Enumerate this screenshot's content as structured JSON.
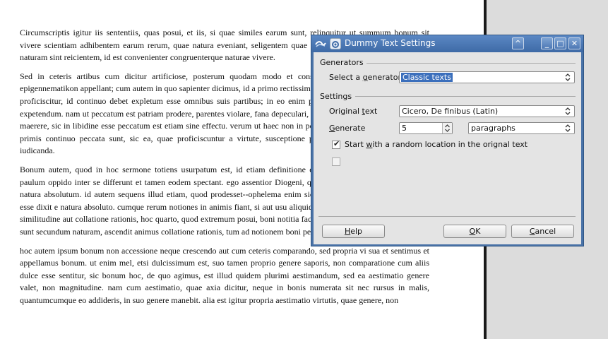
{
  "document": {
    "paragraphs": [
      "Circumscriptis igitur iis sententiis, quas posui, et iis, si quae similes earum sunt, relinquitur ut summum bonum sit vivere scientiam adhibentem earum rerum, quae natura eveniant, seligentem quae secundum naturam et quae contra naturam sint reicientem, id est convenienter congruenterque naturae vivere.",
      "Sed in ceteris artibus cum dicitur artificiose, posterum quodam modo et consequens putandum est, quod illi epigennematikon appellant; cum autem in quo sapienter dicimus, id a primo rectissime dicitur. quicquid enim a sapientia proficiscitur, id continuo debet expletum esse omnibus suis partibus; in eo enim positum est id, quod dicimus esse expetendum. nam ut peccatum est patriam prodere, parentes violare, fana depeculari, quae sunt in effectu, sic timere, sic maerere, sic in libidine esse peccatum est etiam sine effectu. verum ut haec non in posteris et in consequentibus, sed in primis continuo peccata sunt, sic ea, quae proficiscuntur a virtute, susceptione prima, non perfectione recta sunt iudicanda.",
      "Bonum autem, quod in hoc sermone totiens usurpatum est, id etiam definitione explicatur. sed eorum definitiones paulum oppido inter se differunt et tamen eodem spectant. ego assentior Diogeni, qui bonum definierit id, quod esset natura absolutum. id autem sequens illud etiam, quod prodesset--ophelema enim sic appellemus--, motum aut statum esse dixit e natura absoluto. cumque rerum notiones in animis fiant, si aut usu aliquid cognitum sit aut coniunctione aut similitudine aut collatione rationis, hoc quarto, quod extremum posui, boni notitia facta est. cum enim ab iis rebus, quae sunt secundum naturam, ascendit animus collatione rationis, tum ad notionem boni pervenit.",
      "hoc autem ipsum bonum non accessione neque crescendo aut cum ceteris comparando, sed propria vi sua et sentimus et appellamus bonum. ut enim mel, etsi dulcissimum est, suo tamen proprio genere saporis, non comparatione cum aliis dulce esse sentitur, sic bonum hoc, de quo agimus, est illud quidem plurimi aestimandum, sed ea aestimatio genere valet, non magnitudine. nam cum aestimatio, quae axia dicitur, neque in bonis numerata sit nec rursus in malis, quantumcumque eo addideris, in suo genere manebit. alia est igitur propria aestimatio virtutis, quae genere, non"
    ]
  },
  "dialog": {
    "title": "Dummy Text Settings",
    "titlebar_buttons": {
      "shade": "^",
      "minimize": "_",
      "maximize": "□",
      "close": "✕"
    },
    "generators": {
      "section_label": "Generators",
      "select_label_pre": "Select a ",
      "select_label_u": "g",
      "select_label_post": "enerator",
      "selected_value": "Classic texts"
    },
    "settings": {
      "section_label": "Settings",
      "original_label_pre": "Original ",
      "original_label_u": "t",
      "original_label_post": "ext",
      "original_value": "Cicero, De finibus (Latin)",
      "generate_label_u": "G",
      "generate_label_post": "enerate",
      "generate_count": "5",
      "generate_unit": "paragraphs",
      "random_start_checked": true,
      "random_start_pre": "Start ",
      "random_start_u": "w",
      "random_start_post": "ith a random location in the orignal text",
      "second_option_checked": false
    },
    "buttons": {
      "help_u": "H",
      "help_post": "elp",
      "ok_u": "O",
      "ok_post": "K",
      "cancel_u": "C",
      "cancel_post": "ancel"
    }
  },
  "colors": {
    "titlebar": "#4a73a8",
    "selection": "#3b6fbc",
    "dialog_body": "#e4e4e4",
    "canvas_background": "#dcdcdc"
  }
}
